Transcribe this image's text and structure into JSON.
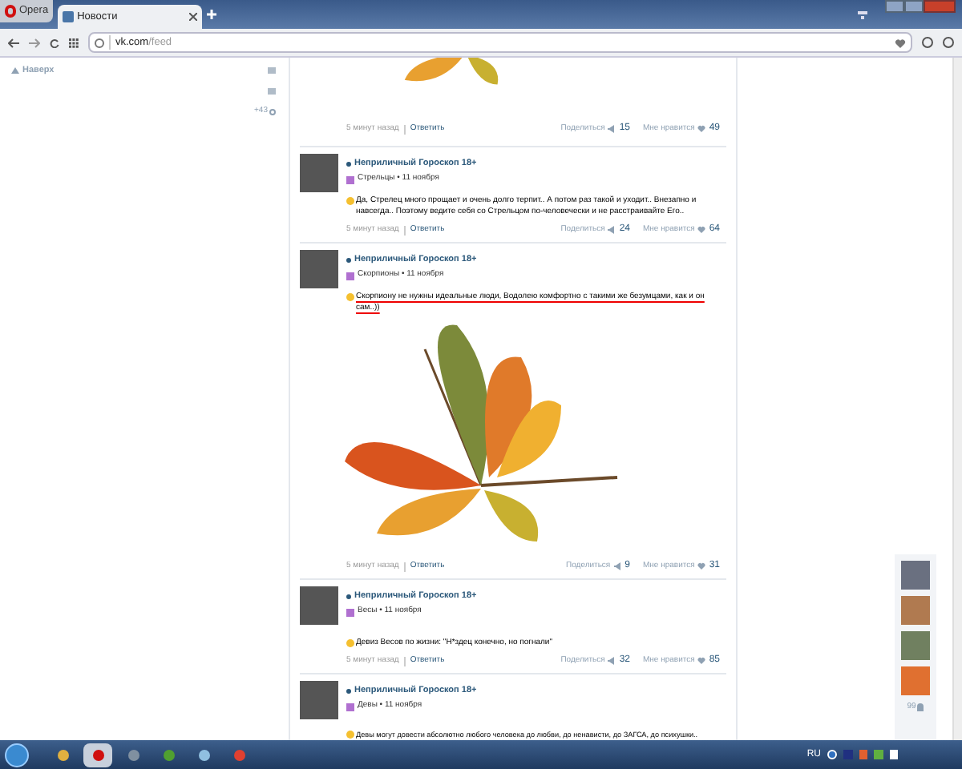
{
  "browser": {
    "menu_label": "Opera",
    "tabs": [
      {
        "title": "Новости",
        "selected": true
      }
    ],
    "url": {
      "host": "vk.com",
      "path": "/feed"
    }
  },
  "sidebar": {
    "back_to_top": "Наверх",
    "counter": "+43"
  },
  "posts": [
    {
      "kind": "partial",
      "has_picture": true,
      "time": "5 минут назад",
      "reply": "Ответить",
      "share_label": "Поделиться",
      "shares": "15",
      "like_label": "Мне нравится",
      "likes": "49"
    },
    {
      "kind": "full",
      "author": "Неприличный Гороскоп 18+",
      "sign_line": "Стрельцы • 11 ноября",
      "text": "Да, Стрелец много прощает и очень долго терпит.. А потом раз такой и уходит.. Внезапно и навсегда.. Поэтому ведите себя со Стрельцом по-человечески и не расстраивайте Его..",
      "underlined": false,
      "has_picture": false,
      "time": "5 минут назад",
      "reply": "Ответить",
      "share_label": "Поделиться",
      "shares": "24",
      "like_label": "Мне нравится",
      "likes": "64"
    },
    {
      "kind": "full",
      "author": "Неприличный Гороскоп 18+",
      "sign_line": "Скорпионы • 11 ноября",
      "text": "Скорпиону не нужны идеальные люди, Водолею комфортно с такими же безумцами, как и он сам..))",
      "underlined": true,
      "has_picture": true,
      "time": "5 минут назад",
      "reply": "Ответить",
      "share_label": "Поделиться",
      "shares": "9",
      "like_label": "Мне нравится",
      "likes": "31"
    },
    {
      "kind": "full",
      "author": "Неприличный Гороскоп 18+",
      "sign_line": "Весы • 11 ноября",
      "text": "Девиз Весов по жизни: \"Н*здец конечно, но погнали\"",
      "underlined": false,
      "has_picture": false,
      "time": "5 минут назад",
      "reply": "Ответить",
      "share_label": "Поделиться",
      "shares": "32",
      "like_label": "Мне нравится",
      "likes": "85"
    },
    {
      "kind": "cut",
      "author": "Неприличный Гороскоп 18+",
      "sign_line": "Девы • 11 ноября",
      "text": "Девы могут довести абсолютно любого человека до любви, до ненависти, до ЗАГСА, до психушки..",
      "underlined": false,
      "has_picture": false
    }
  ],
  "friends": {
    "count": "99"
  },
  "taskbar": {
    "apps": [
      {
        "selected": false
      },
      {
        "selected": true
      },
      {
        "selected": false
      },
      {
        "selected": false
      },
      {
        "selected": false
      },
      {
        "selected": false
      }
    ],
    "language": "RU"
  }
}
